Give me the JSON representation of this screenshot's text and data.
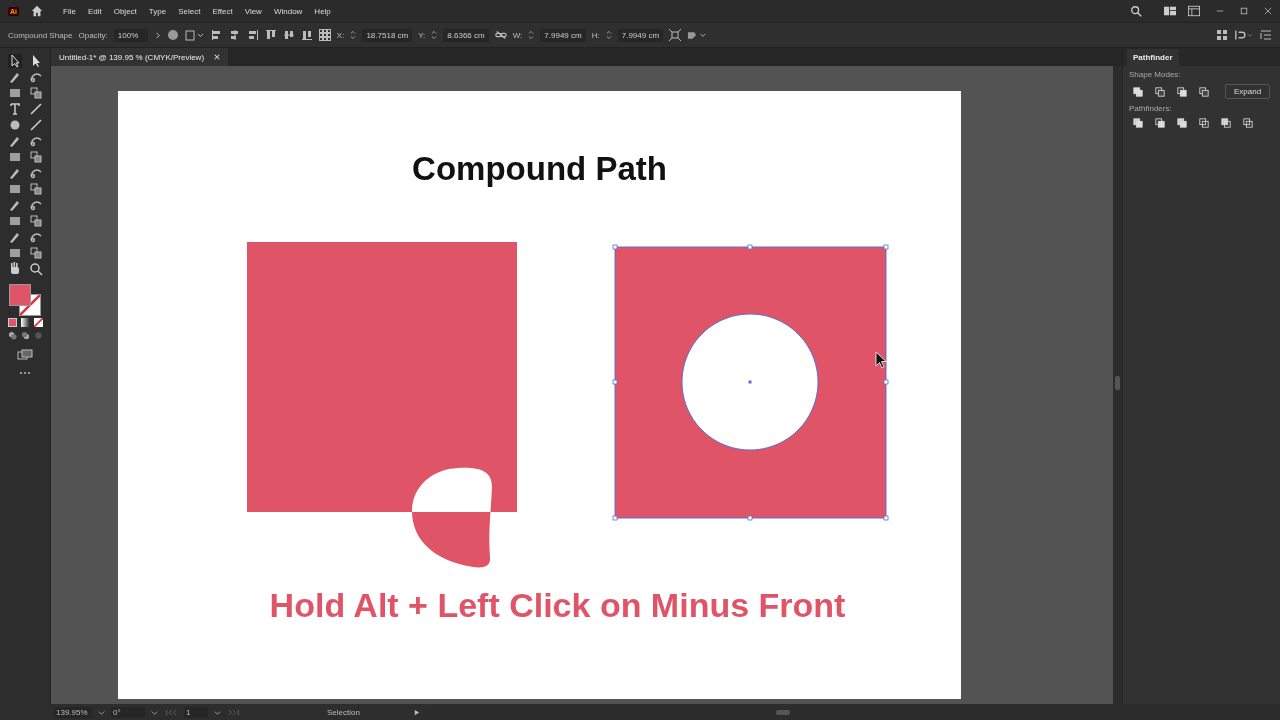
{
  "menu": [
    "File",
    "Edit",
    "Object",
    "Type",
    "Select",
    "Effect",
    "View",
    "Window",
    "Help"
  ],
  "app_badge": "Ai",
  "control_bar": {
    "selection_label": "Compound Shape",
    "opacity_label": "Opacity:",
    "opacity_value": "100%",
    "fields": [
      {
        "label": "X:",
        "value": "18.7518 cm"
      },
      {
        "label": "Y:",
        "value": "8.6366 cm"
      },
      {
        "label": "W:",
        "value": "7.9949 cm"
      },
      {
        "label": "H:",
        "value": "7.9949 cm"
      }
    ]
  },
  "document_tabs": [
    {
      "title": "Untitled-1* @ 139.95 % (CMYK/Preview)",
      "selected": true
    }
  ],
  "artboard": {
    "title": "Compound Path",
    "caption": "Hold Alt + Left Click on Minus Front"
  },
  "pathfinder_panel": {
    "tab": "Pathfinder",
    "shape_modes_label": "Shape Modes:",
    "expand_button": "Expand",
    "pathfinders_label": "Pathfinders:"
  },
  "status_bar": {
    "zoom": "139.95%",
    "rotation": "0°",
    "artboard": "1",
    "tool": "Selection"
  }
}
